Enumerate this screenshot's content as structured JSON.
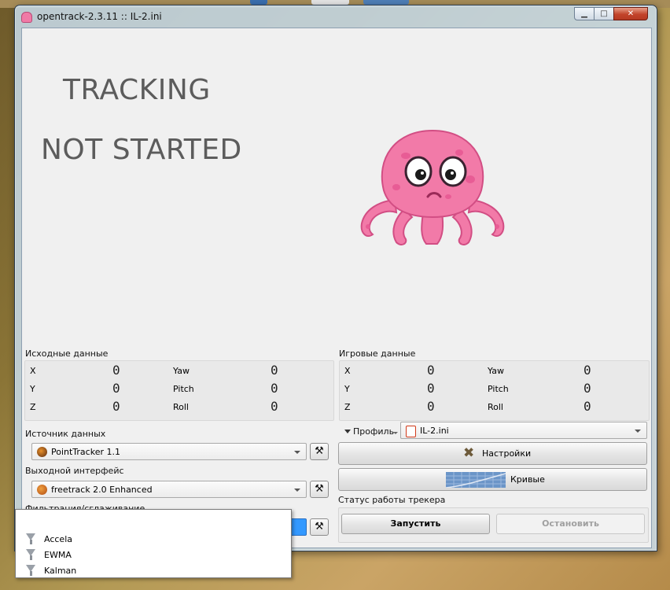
{
  "window": {
    "title": "opentrack-2.3.11 :: IL-2.ini",
    "minimize_glyph": "▁",
    "maximize_glyph": "□",
    "close_glyph": "✕"
  },
  "video": {
    "status_line1": "TRACKING",
    "status_line2": "NOT STARTED",
    "mascot": "octopus"
  },
  "raw_pose": {
    "label": "Исходные данные",
    "rows": [
      {
        "axis": "X",
        "value": "0",
        "rot_axis": "Yaw",
        "rot_value": "0"
      },
      {
        "axis": "Y",
        "value": "0",
        "rot_axis": "Pitch",
        "rot_value": "0"
      },
      {
        "axis": "Z",
        "value": "0",
        "rot_axis": "Roll",
        "rot_value": "0"
      }
    ]
  },
  "game_pose": {
    "label": "Игровые данные",
    "rows": [
      {
        "axis": "X",
        "value": "0",
        "rot_axis": "Yaw",
        "rot_value": "0"
      },
      {
        "axis": "Y",
        "value": "0",
        "rot_axis": "Pitch",
        "rot_value": "0"
      },
      {
        "axis": "Z",
        "value": "0",
        "rot_axis": "Roll",
        "rot_value": "0"
      }
    ]
  },
  "tracker": {
    "label": "Источник данных",
    "selected": "PointTracker 1.1",
    "icon": "pointtracker-icon",
    "settings_glyph": "⚒"
  },
  "protocol": {
    "label": "Выходной интерфейс",
    "selected": "freetrack 2.0 Enhanced",
    "icon": "freetrack-icon",
    "settings_glyph": "⚒"
  },
  "filter": {
    "label": "Фильтрация/сглаживание",
    "selected": "",
    "settings_glyph": "⚒",
    "options": [
      "Accela",
      "EWMA",
      "Kalman"
    ]
  },
  "profile": {
    "label": "Профиль",
    "selected": "IL-2.ini"
  },
  "buttons": {
    "settings": "Настройки",
    "curves": "Кривые",
    "start": "Запустить",
    "stop": "Остановить"
  },
  "status": {
    "label": "Статус работы трекера"
  },
  "colors": {
    "selection": "#3399ff",
    "mascot_pink": "#f27aa8",
    "status_text": "#5c5c5c"
  }
}
